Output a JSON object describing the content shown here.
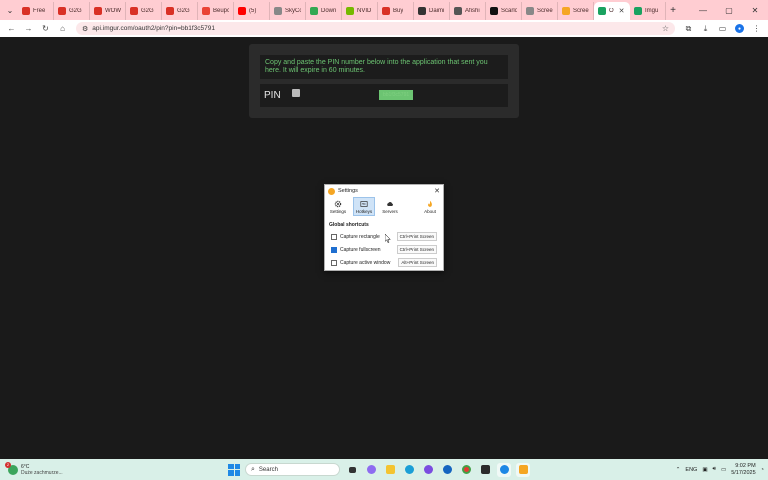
{
  "browser": {
    "tabs": [
      {
        "label": "Free",
        "color": "#d93025"
      },
      {
        "label": "G2G",
        "color": "#d93025"
      },
      {
        "label": "WOW",
        "color": "#d93025"
      },
      {
        "label": "G2G",
        "color": "#d93025"
      },
      {
        "label": "G2G",
        "color": "#d93025"
      },
      {
        "label": "Beupc",
        "color": "#ea4335"
      },
      {
        "label": "(5)",
        "color": "#ff0000"
      },
      {
        "label": "SkyCo",
        "color": "#888888"
      },
      {
        "label": "Down",
        "color": "#34a853"
      },
      {
        "label": "NVID",
        "color": "#76b900"
      },
      {
        "label": "Buy",
        "color": "#d93025"
      },
      {
        "label": "Daimi",
        "color": "#333333"
      },
      {
        "label": "Afishi",
        "color": "#555555"
      },
      {
        "label": "Scarlo",
        "color": "#111111"
      },
      {
        "label": "Scree",
        "color": "#888888"
      },
      {
        "label": "Scree",
        "color": "#f5a623"
      },
      {
        "label": "O",
        "color": "#1aa260",
        "active": true
      },
      {
        "label": "Imgu",
        "color": "#1aa260"
      }
    ],
    "url": "api.imgur.com/oauth2/pin?pin=bb1f3c5791"
  },
  "page": {
    "message": "Copy and paste the PIN number below into the application that sent you here. It will expire in 60 minutes.",
    "pin_label": "PIN",
    "pin_value": "bb1f3c5791",
    "accent": "#6cc472"
  },
  "dialog": {
    "title": "Settings",
    "tabs": [
      "Settings",
      "Hotkeys",
      "Servers",
      "About"
    ],
    "active_tab": "Hotkeys",
    "section": "Global shortcuts",
    "rows": [
      {
        "label": "Capture rectangle",
        "key": "Ctrl+Print Screen",
        "checked": false
      },
      {
        "label": "Capture fullscreen",
        "key": "Ctrl+Print Screen",
        "checked": true
      },
      {
        "label": "Capture active window",
        "key": "Alt+Print Screen",
        "checked": false
      }
    ]
  },
  "taskbar": {
    "temp": "6°C",
    "condition": "Duże zachmurze...",
    "weather_badge": "2",
    "search_placeholder": "Search",
    "lang": "ENG",
    "time": "9:02 PM",
    "date": "5/17/2025"
  }
}
